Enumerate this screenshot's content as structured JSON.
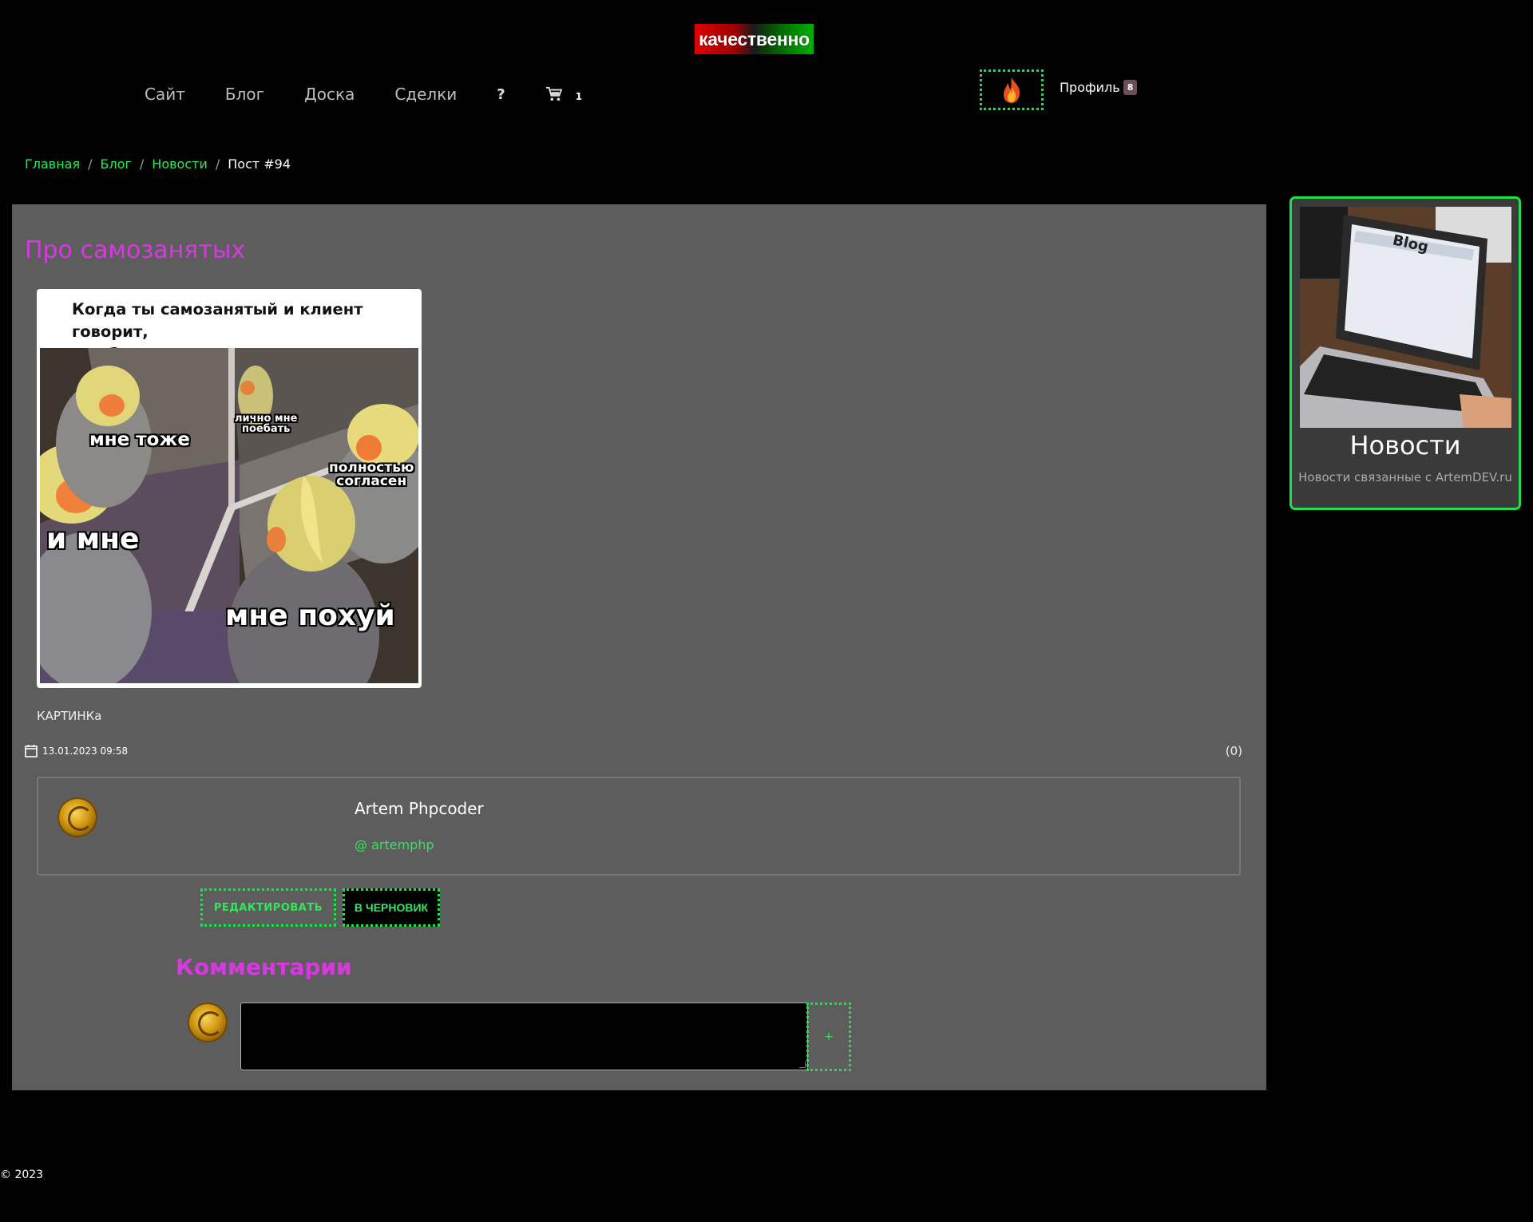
{
  "brand": {
    "logo_text": "качественно"
  },
  "nav": {
    "items": [
      "Сайт",
      "Блог",
      "Доска",
      "Сделки"
    ],
    "help_label": "?",
    "cart_count": "1"
  },
  "user": {
    "profile_label": "Профиль",
    "profile_badge": "8"
  },
  "breadcrumb": {
    "items": [
      "Главная",
      "Блог",
      "Новости"
    ],
    "separator": "/",
    "current": "Пост #94"
  },
  "post": {
    "title": "Про самозанятых",
    "meme": {
      "caption_line1": "Когда ты самозанятый и клиент говорит,",
      "caption_line2": "что будет жаловаться руководству",
      "labels": {
        "me_too": "мне тоже",
        "personally_line1": "лично мне",
        "personally_line2": "поебать",
        "agree_line1": "полностью",
        "agree_line2": "согласен",
        "and_me": "и мне",
        "dont_care": "мне похуй"
      }
    },
    "image_label": "КАРТИНКа",
    "date": "13.01.2023 09:58",
    "comments_count": "(0)",
    "author": {
      "name": "Artem Phpcoder",
      "handle": "@ artemphp"
    },
    "edit_label": "РЕДАКТИРОВАТЬ",
    "draft_label": "В ЧЕРНОВИК"
  },
  "comments": {
    "title": "Комментарии",
    "submit_label": "+",
    "input_value": ""
  },
  "sidebar": {
    "card_title": "Новости",
    "card_desc": "Новости связанные с ArtemDEV.ru",
    "image_text": "Blog"
  },
  "footer": {
    "copyright": "© 2023"
  },
  "colors": {
    "accent_green": "#1de04a",
    "title_magenta": "#d63adf",
    "panel_gray": "#5e5d5e"
  }
}
